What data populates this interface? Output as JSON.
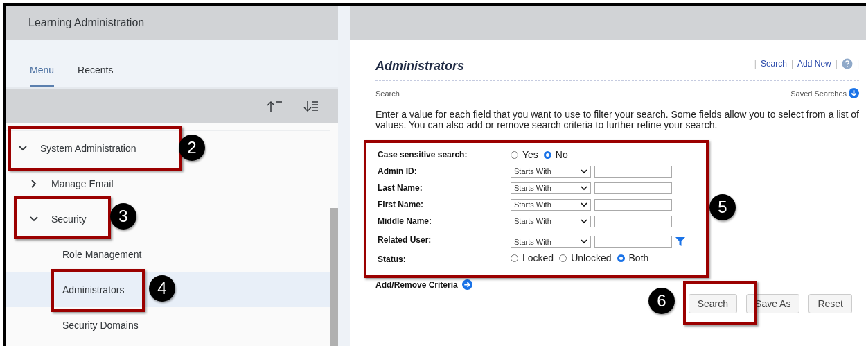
{
  "header": {
    "title": "Learning Administration"
  },
  "tabs": [
    {
      "label": "Menu",
      "selected": true
    },
    {
      "label": "Recents",
      "selected": false
    }
  ],
  "tree": [
    {
      "label": "System Administration",
      "expanded": true,
      "selected": false,
      "children": [
        {
          "label": "Manage Email",
          "expanded": false,
          "selected": false
        },
        {
          "label": "Security",
          "expanded": true,
          "selected": false,
          "children": [
            {
              "label": "Role Management",
              "selected": false
            },
            {
              "label": "Administrators",
              "selected": true
            },
            {
              "label": "Security Domains",
              "selected": false
            }
          ]
        }
      ]
    }
  ],
  "page": {
    "title": "Administrators",
    "link_bar": [
      {
        "kind": "separator",
        "text": "|"
      },
      {
        "kind": "link",
        "text": "Search"
      },
      {
        "kind": "separator",
        "text": "|"
      },
      {
        "kind": "link",
        "text": "Add New"
      },
      {
        "kind": "separator",
        "text": "|"
      },
      {
        "kind": "help"
      },
      {
        "kind": "separator",
        "text": "|"
      }
    ],
    "section": "Search",
    "saved_searches": "Saved Searches",
    "instructions": "Enter a value for each field that you want to use to filter your search. Some fields allow you to select from a list of values. You can also add or remove search criteria to further refine your search.",
    "case_sensitive": {
      "label": "Case sensitive search:",
      "options": [
        {
          "label": "Yes",
          "selected": false
        },
        {
          "label": "No",
          "selected": true
        }
      ]
    },
    "fields": [
      {
        "label": "Admin ID:",
        "operator": "Starts With",
        "filter": false
      },
      {
        "label": "Last Name:",
        "operator": "Starts With",
        "filter": false
      },
      {
        "label": "First Name:",
        "operator": "Starts With",
        "filter": false
      },
      {
        "label": "Middle Name:",
        "operator": "Starts With",
        "filter": false
      },
      {
        "label": "Related User:",
        "operator": "Starts With",
        "filter": true
      }
    ],
    "status": {
      "label": "Status:",
      "options": [
        {
          "label": "Locked",
          "selected": false
        },
        {
          "label": "Unlocked",
          "selected": false
        },
        {
          "label": "Both",
          "selected": true
        }
      ]
    },
    "add_remove": "Add/Remove Criteria",
    "buttons": [
      "Search",
      "Save As",
      "Reset"
    ]
  },
  "annotations": [
    {
      "number": "2"
    },
    {
      "number": "3"
    },
    {
      "number": "4"
    },
    {
      "number": "5"
    },
    {
      "number": "6"
    }
  ]
}
